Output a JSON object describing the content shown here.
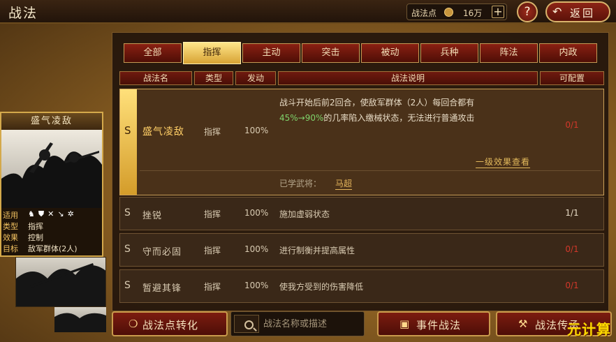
{
  "header": {
    "title": "战法",
    "points_label": "战法点",
    "points_value": "16万",
    "plus_glyph": "+",
    "help_glyph": "?",
    "back_label": "返回",
    "back_icon": "↶"
  },
  "general_card": {
    "name": "盛气凌敌",
    "rows": [
      {
        "key": "适用",
        "value": ""
      },
      {
        "key": "类型",
        "value": "指挥"
      },
      {
        "key": "效果",
        "value": "控制"
      },
      {
        "key": "目标",
        "value": "敌军群体(2人)"
      }
    ],
    "troop_icons": [
      "cavalry-icon",
      "shield-icon",
      "bow-icon",
      "spear-icon",
      "siege-icon"
    ]
  },
  "tabs": [
    {
      "label": "全部",
      "active": false
    },
    {
      "label": "指挥",
      "active": true
    },
    {
      "label": "主动",
      "active": false
    },
    {
      "label": "突击",
      "active": false
    },
    {
      "label": "被动",
      "active": false
    },
    {
      "label": "兵种",
      "active": false
    },
    {
      "label": "阵法",
      "active": false
    },
    {
      "label": "内政",
      "active": false
    }
  ],
  "columns": {
    "name": "战法名",
    "type": "类型",
    "trigger": "发动",
    "desc": "战法说明",
    "config": "可配置"
  },
  "rows": [
    {
      "grade": "S",
      "name": "盛气凌敌",
      "type": "指挥",
      "trigger": "100%",
      "desc_line1": "战斗开始后前2回合，使敌军群体（2人）每回合都有",
      "desc_pct": "45%→90%",
      "desc_line2_rest": "的几率陷入缴械状态，无法进行普通攻击",
      "config": "0/1",
      "effect_link": "一级效果查看",
      "learned_label": "已学武将：",
      "learned_name": "马超"
    },
    {
      "grade": "S",
      "name": "挫锐",
      "type": "指挥",
      "trigger": "100%",
      "desc": "施加虚弱状态",
      "config": "1/1"
    },
    {
      "grade": "S",
      "name": "守而必固",
      "type": "指挥",
      "trigger": "100%",
      "desc": "进行制衡并提高属性",
      "config": "0/1"
    },
    {
      "grade": "S",
      "name": "暂避其锋",
      "type": "指挥",
      "trigger": "100%",
      "desc": "使我方受到的伤害降低",
      "config": "0/1"
    }
  ],
  "bottom": {
    "convert_label": "战法点转化",
    "convert_icon": "❍",
    "search_placeholder": "战法名称或描述",
    "event_label": "事件战法",
    "event_icon": "▣",
    "inherit_label": "战法传承",
    "inherit_icon": "⚒"
  },
  "watermark": "元计算",
  "colors": {
    "config_full": "#e8dcc6",
    "config_empty": "#d2382a",
    "highlight_pct": "#7fd36b",
    "accent_gold": "#e2b95c"
  }
}
